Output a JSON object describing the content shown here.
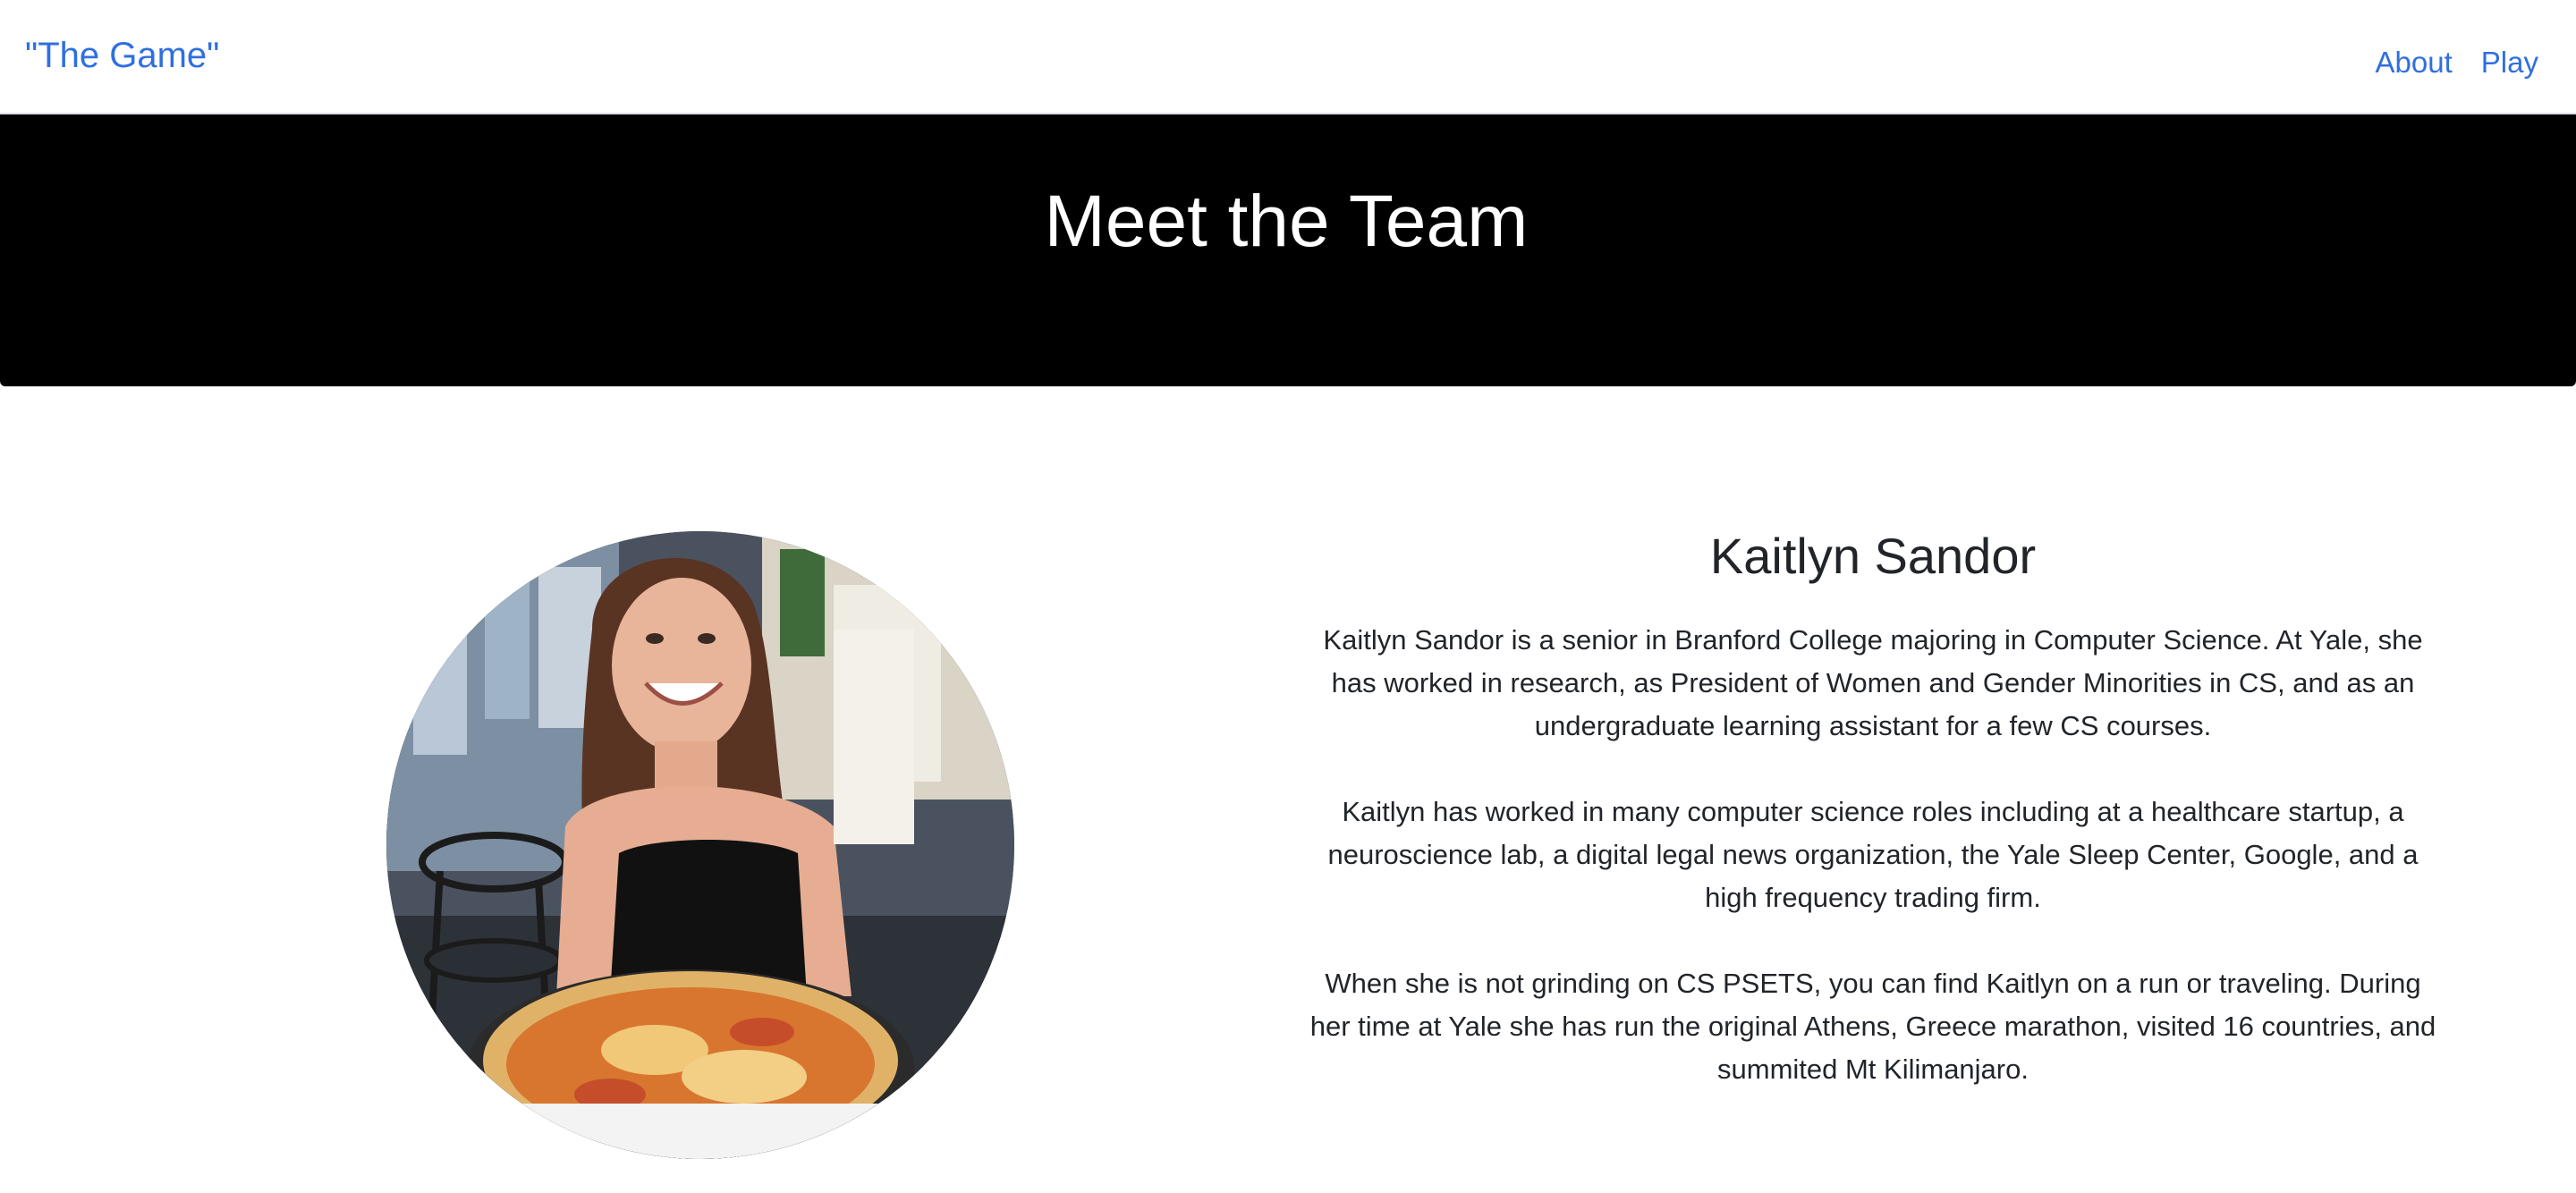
{
  "navbar": {
    "brand": "\"The Game\"",
    "links": [
      "About",
      "Play"
    ]
  },
  "hero": {
    "title": "Meet the Team"
  },
  "member": {
    "name": "Kaitlyn Sandor",
    "paragraphs": [
      "Kaitlyn Sandor is a senior in Branford College majoring in Computer Science. At Yale, she has worked in research, as President of Women and Gender Minorities in CS, and as an undergraduate learning assistant for a few CS courses.",
      "Kaitlyn has worked in many computer science roles including at a healthcare startup, a neuroscience lab, a digital legal news organization, the Yale Sleep Center, Google, and a high frequency trading firm.",
      "When she is not grinding on CS PSETS, you can find Kaitlyn on a run or traveling. During her time at Yale she has run the original Athens, Greece marathon, visited 16 countries, and summited Mt Kilimanjaro."
    ]
  },
  "colors": {
    "link": "#2f6fe0",
    "hero_bg": "#000000",
    "hero_text": "#ffffff",
    "body_text": "#212529"
  }
}
